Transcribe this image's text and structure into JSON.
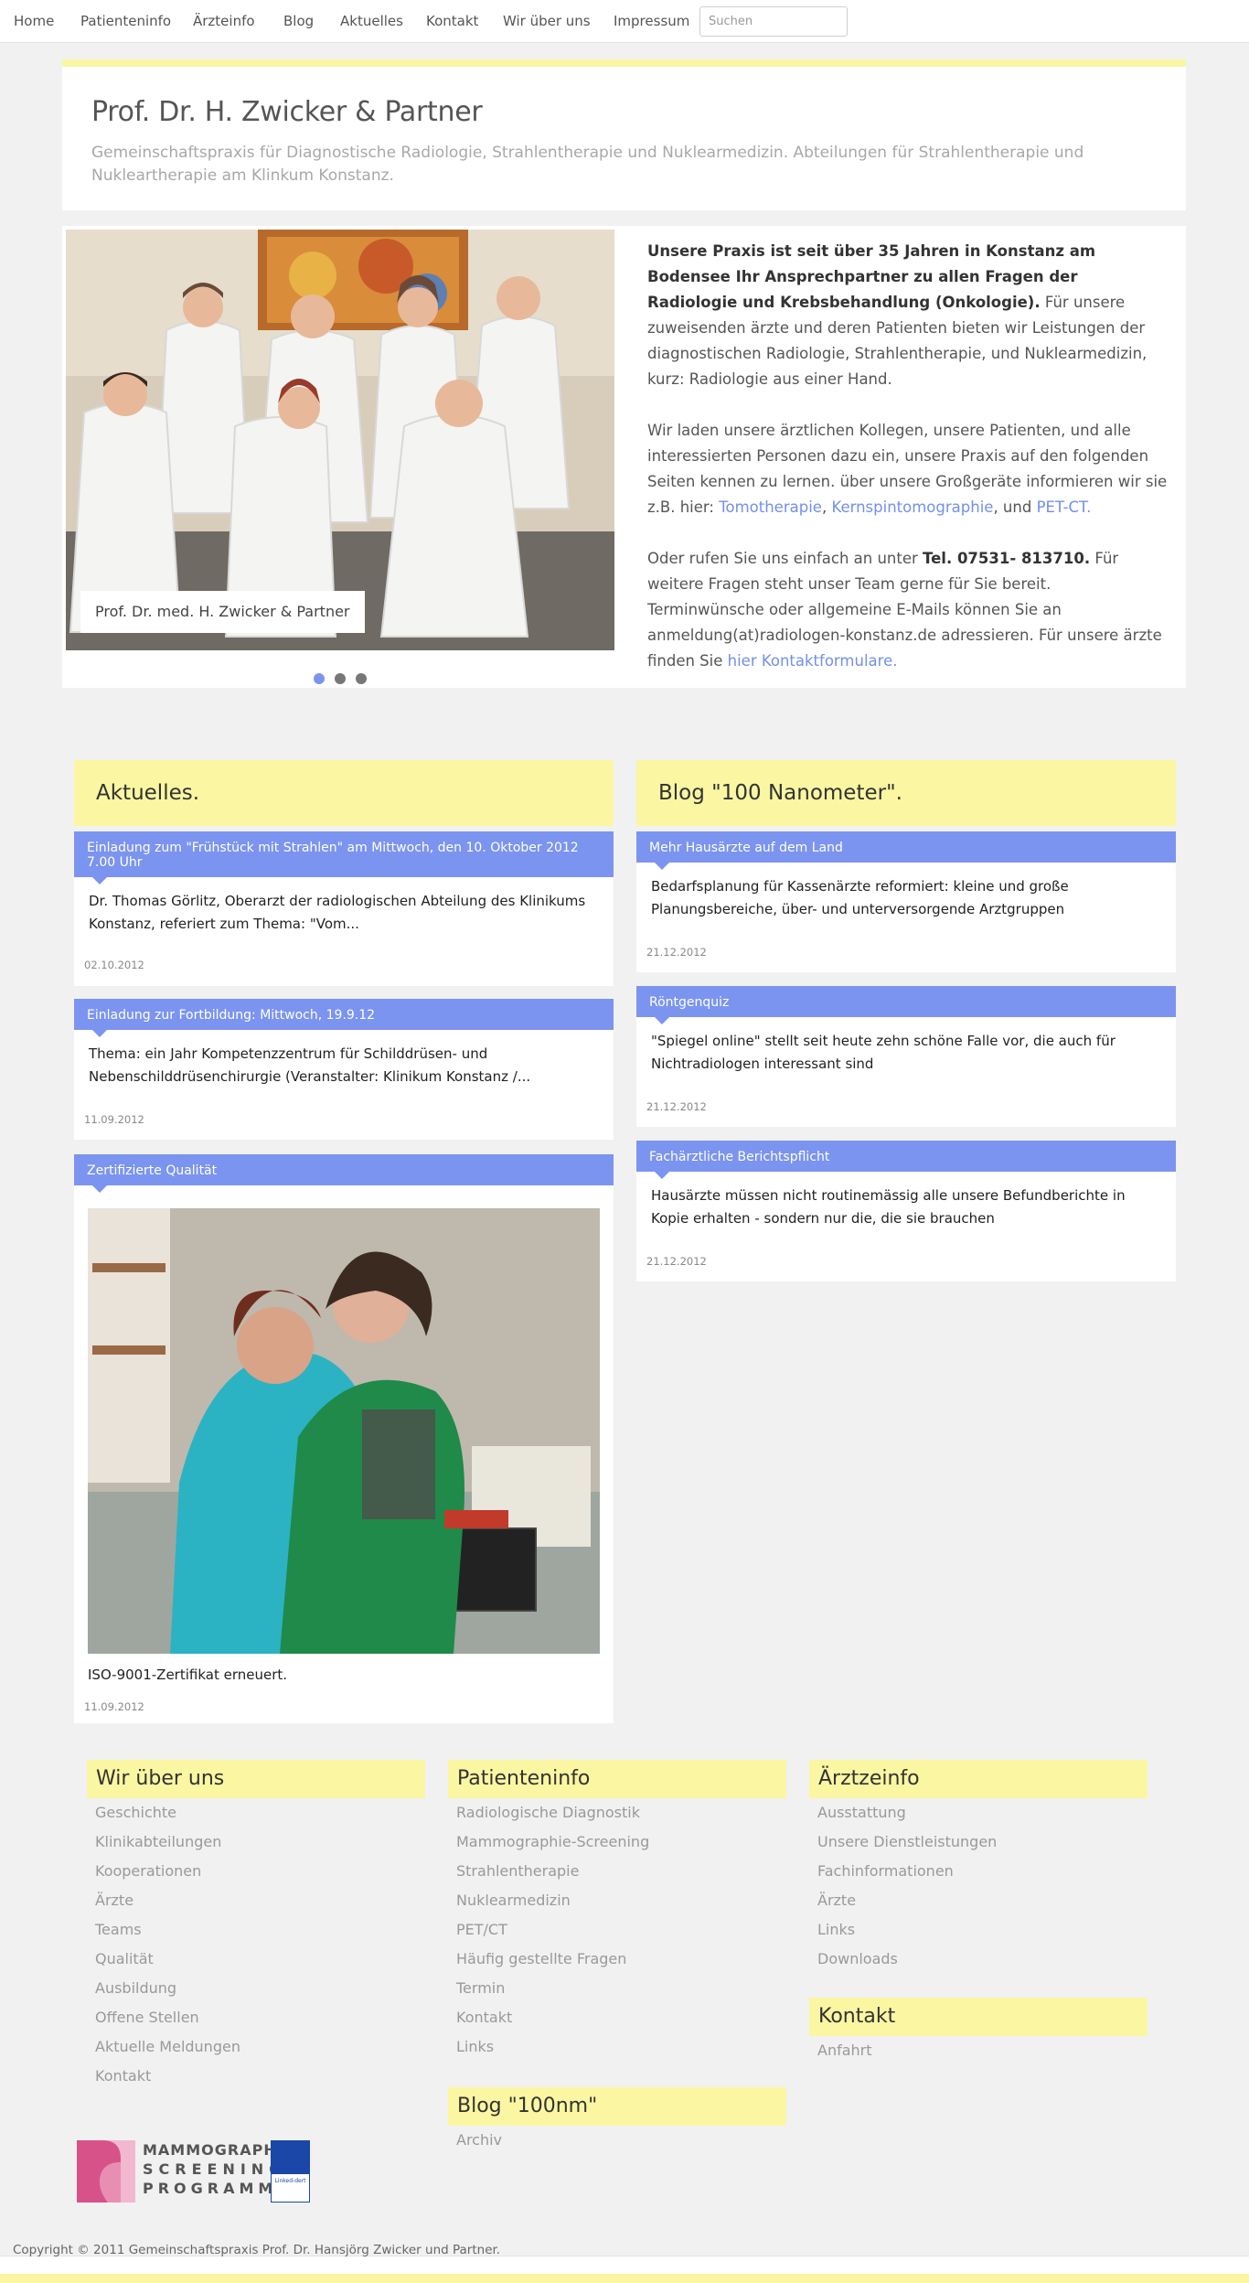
{
  "nav": {
    "items": [
      "Home",
      "Patienteninfo",
      "Ärzteinfo",
      "Blog",
      "Aktuelles",
      "Kontakt",
      "Wir über uns",
      "Impressum"
    ],
    "search_placeholder": "Suchen"
  },
  "header": {
    "title": "Prof. Dr. H. Zwicker & Partner",
    "subtitle": "Gemeinschaftspraxis für Diagnostische Radiologie, Strahlentherapie und Nuklearmedizin. Abteilungen für Strahlentherapie und Nukleartherapie am Klinkum Konstanz."
  },
  "slider": {
    "caption": "Prof. Dr. med. H. Zwicker & Partner",
    "dot_count": 3,
    "active_dot": 0
  },
  "intro": {
    "p1_bold": "Unsere Praxis ist seit über 35 Jahren in Konstanz am Bodensee Ihr Ansprechpartner zu allen Fragen der Radiologie und Krebsbehandlung (Onkologie).",
    "p1_rest": " Für unsere zuweisenden ärzte und deren Patienten bieten wir Leistungen der diagnostischen Radiologie, Strahlentherapie, und Nuklearmedizin, kurz: Radiologie aus einer Hand.",
    "p2_text": "Wir laden unsere ärztlichen Kollegen, unsere Patienten, und alle interessierten Personen dazu ein, unsere Praxis auf den folgenden Seiten kennen zu lernen. über unsere Großgeräte informieren wir sie z.B. hier: ",
    "link_tomo": "Tomotherapie",
    "sep1": ", ",
    "link_kst": "Kernspintomographie",
    "sep2": ", und ",
    "link_pet": "PET-CT.",
    "p3_start": "Oder rufen Sie uns einfach an unter ",
    "p3_phone": "Tel. 07531- 813710.",
    "p3_rest": " Für weitere Fragen steht unser Team gerne für Sie bereit. Terminwünsche oder allgemeine E-Mails können Sie an anmeldung(at)radiologen-konstanz.de adressieren. Für unsere ärzte finden Sie ",
    "p3_link": "hier Kontaktformulare."
  },
  "news": {
    "heading": "Aktuelles.",
    "posts": [
      {
        "title": "Einladung zum \"Frühstück mit Strahlen\" am Mittwoch, den 10. Oktober 2012 7.00 Uhr",
        "excerpt": "Dr. Thomas Görlitz, Oberarzt der radiologischen Abteilung des Klinikums Konstanz, referiert zum Thema: \"Vom...",
        "date": "02.10.2012"
      },
      {
        "title": "Einladung zur Fortbildung: Mittwoch, 19.9.12",
        "excerpt": "Thema: ein Jahr Kompetenzzentrum für Schilddrüsen- und Nebenschilddrüsenchirurgie (Veranstalter: Klinikum Konstanz /...",
        "date": "11.09.2012"
      },
      {
        "title": "Zertifizierte Qualität",
        "excerpt": "ISO-9001-Zertifikat erneuert.",
        "date": "11.09.2012"
      }
    ]
  },
  "blog": {
    "heading": "Blog \"100 Nanometer\".",
    "posts": [
      {
        "title": "Mehr Hausärzte auf dem Land",
        "excerpt": "Bedarfsplanung für Kassenärzte reformiert: kleine und große Planungsbereiche, über- und unterversorgende Arztgruppen",
        "date": "21.12.2012"
      },
      {
        "title": "Röntgenquiz",
        "excerpt": "\"Spiegel online\" stellt seit heute zehn schöne Falle vor, die auch für Nichtradiologen interessant sind",
        "date": "21.12.2012"
      },
      {
        "title": "Fachärztliche Berichtspflicht",
        "excerpt": "Hausärzte müssen nicht routinemässig alle unsere Befundberichte in Kopie erhalten - sondern nur die, die sie brauchen",
        "date": "21.12.2012"
      }
    ]
  },
  "footer": {
    "wir": {
      "heading": "Wir über uns",
      "links": [
        "Geschichte",
        "Klinikabteilungen",
        "Kooperationen",
        "Ärzte",
        "Teams",
        "Qualität",
        "Ausbildung",
        "Offene Stellen",
        "Aktuelle Meldungen",
        "Kontakt"
      ]
    },
    "patienten": {
      "heading": "Patienteninfo",
      "links": [
        "Radiologische Diagnostik",
        "Mammographie-Screening",
        "Strahlentherapie",
        "Nuklearmedizin",
        "PET/CT",
        "Häufig gestellte Fragen",
        "Termin",
        "Kontakt",
        "Links"
      ]
    },
    "blog100": {
      "heading": "Blog \"100nm\"",
      "links": [
        "Archiv"
      ]
    },
    "aerzte": {
      "heading": "Ärztzeinfo",
      "links": [
        "Ausstattung",
        "Unsere Dienstleistungen",
        "Fachinformationen",
        "Ärzte",
        "Links",
        "Downloads"
      ]
    },
    "kontakt": {
      "heading": "Kontakt",
      "links": [
        "Anfahrt"
      ]
    }
  },
  "logo": {
    "line1": "MAMMOGRAPHIE",
    "line2": "SCREENING",
    "line3": "PROGRAMM",
    "badge": "Linked-dert"
  },
  "copyright": "Copyright © 2011 Gemeinschaftspraxis Prof. Dr. Hansjörg Zwicker und Partner.",
  "colors": {
    "accent_yellow": "#fbf6a2",
    "accent_blue": "#7b94ef",
    "link_blue": "#7390e8"
  }
}
